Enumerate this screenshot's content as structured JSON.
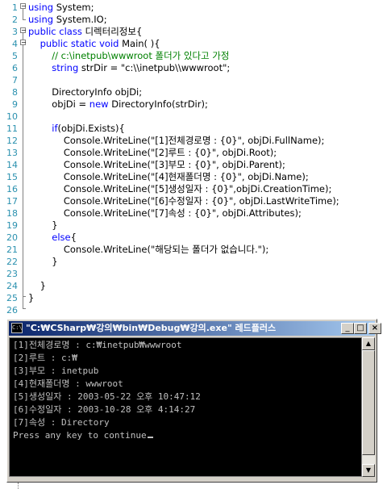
{
  "editor": {
    "lines": [
      {
        "n": "1",
        "tokens": [
          {
            "c": "kw",
            "t": "using"
          },
          {
            "c": "tx",
            "t": " System;"
          }
        ]
      },
      {
        "n": "2",
        "tokens": [
          {
            "c": "kw",
            "t": "using"
          },
          {
            "c": "tx",
            "t": " System.IO;"
          }
        ]
      },
      {
        "n": "3",
        "tokens": [
          {
            "c": "kw",
            "t": "public class"
          },
          {
            "c": "tx",
            "t": " 디렉터리정보{"
          }
        ]
      },
      {
        "n": "4",
        "tokens": [
          {
            "c": "tx",
            "t": "    "
          },
          {
            "c": "kw",
            "t": "public static void"
          },
          {
            "c": "tx",
            "t": " Main( ){"
          }
        ]
      },
      {
        "n": "5",
        "tokens": [
          {
            "c": "tx",
            "t": "        "
          },
          {
            "c": "cm",
            "t": "// c:\\inetpub\\wwwroot 폴더가 있다고 가정"
          }
        ]
      },
      {
        "n": "6",
        "tokens": [
          {
            "c": "tx",
            "t": "        "
          },
          {
            "c": "kw",
            "t": "string"
          },
          {
            "c": "tx",
            "t": " strDir = \"c:\\\\inetpub\\\\wwwroot\";"
          }
        ]
      },
      {
        "n": "7",
        "tokens": []
      },
      {
        "n": "8",
        "tokens": [
          {
            "c": "tx",
            "t": "        DirectoryInfo objDi;"
          }
        ]
      },
      {
        "n": "9",
        "tokens": [
          {
            "c": "tx",
            "t": "        objDi = "
          },
          {
            "c": "kw",
            "t": "new"
          },
          {
            "c": "tx",
            "t": " DirectoryInfo(strDir);"
          }
        ]
      },
      {
        "n": "10",
        "tokens": []
      },
      {
        "n": "11",
        "tokens": [
          {
            "c": "tx",
            "t": "        "
          },
          {
            "c": "kw",
            "t": "if"
          },
          {
            "c": "tx",
            "t": "(objDi.Exists){"
          }
        ]
      },
      {
        "n": "12",
        "tokens": [
          {
            "c": "tx",
            "t": "            Console.WriteLine(\"[1]전체경로명 : {0}\", objDi.FullName);"
          }
        ]
      },
      {
        "n": "13",
        "tokens": [
          {
            "c": "tx",
            "t": "            Console.WriteLine(\"[2]루트 : {0}\", objDi.Root);"
          }
        ]
      },
      {
        "n": "14",
        "tokens": [
          {
            "c": "tx",
            "t": "            Console.WriteLine(\"[3]부모 : {0}\", objDi.Parent);"
          }
        ]
      },
      {
        "n": "15",
        "tokens": [
          {
            "c": "tx",
            "t": "            Console.WriteLine(\"[4]현재폴더명 : {0}\", objDi.Name);"
          }
        ]
      },
      {
        "n": "16",
        "tokens": [
          {
            "c": "tx",
            "t": "            Console.WriteLine(\"[5]생성일자 : {0}\",objDi.CreationTime);"
          }
        ]
      },
      {
        "n": "17",
        "tokens": [
          {
            "c": "tx",
            "t": "            Console.WriteLine(\"[6]수정일자 : {0}\", objDi.LastWriteTime);"
          }
        ]
      },
      {
        "n": "18",
        "tokens": [
          {
            "c": "tx",
            "t": "            Console.WriteLine(\"[7]속성 : {0}\", objDi.Attributes);"
          }
        ]
      },
      {
        "n": "19",
        "tokens": [
          {
            "c": "tx",
            "t": "        }"
          }
        ]
      },
      {
        "n": "20",
        "tokens": [
          {
            "c": "tx",
            "t": "        "
          },
          {
            "c": "kw",
            "t": "else"
          },
          {
            "c": "tx",
            "t": "{"
          }
        ]
      },
      {
        "n": "21",
        "tokens": [
          {
            "c": "tx",
            "t": "            Console.WriteLine(\"해당되는 폴더가 없습니다.\");"
          }
        ]
      },
      {
        "n": "22",
        "tokens": [
          {
            "c": "tx",
            "t": "        }"
          }
        ]
      },
      {
        "n": "23",
        "tokens": []
      },
      {
        "n": "24",
        "tokens": [
          {
            "c": "tx",
            "t": "    }"
          }
        ]
      },
      {
        "n": "25",
        "tokens": [
          {
            "c": "tx",
            "t": "}"
          }
        ]
      },
      {
        "n": "26",
        "tokens": []
      }
    ]
  },
  "console": {
    "title": "\"C:₩CSharp₩강의₩bin₩Debug₩강의.exe\" 레드플러스",
    "icon_label": "C:\\",
    "buttons": {
      "minimize": "_",
      "maximize": "□",
      "close": "×"
    },
    "output": [
      "[1]전체경로명 : c:₩inetpub₩wwwroot",
      "[2]루트 : c:₩",
      "[3]부모 : inetpub",
      "[4]현재폴더명 : wwwroot",
      "[5]생성일자 : 2003-05-22 오후 10:47:12",
      "[6]수정일자 : 2003-10-28 오후 4:14:27",
      "[7]속성 : Directory",
      "Press any key to continue"
    ],
    "scroll_up": "▲",
    "scroll_down": "▼"
  },
  "colors": {
    "keyword": "#0000ff",
    "comment": "#008000",
    "line_number": "#2b91af",
    "console_bg": "#000000",
    "console_fg": "#c0c0c0",
    "titlebar_start": "#0a246a",
    "titlebar_end": "#a6caf0"
  }
}
